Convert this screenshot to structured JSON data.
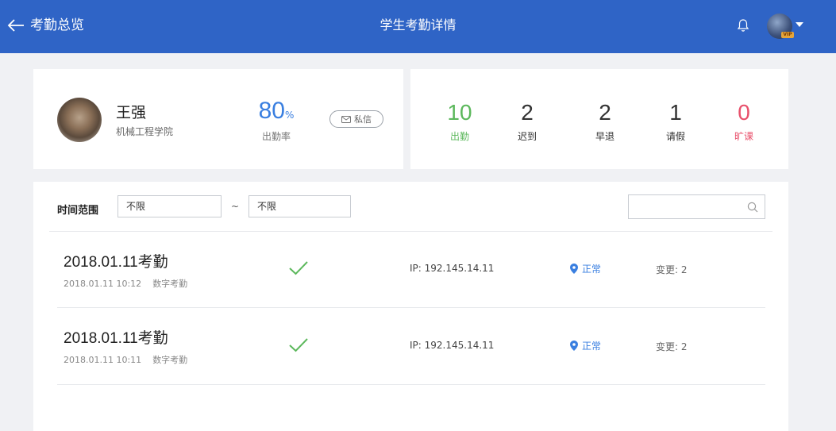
{
  "header": {
    "back_label": "考勤总览",
    "title": "学生考勤详情",
    "vip_badge": "VIP"
  },
  "profile": {
    "name": "王强",
    "school": "机械工程学院",
    "rate_value": "80",
    "rate_unit": "%",
    "rate_label": "出勤率",
    "message_button": "私信"
  },
  "stats": [
    {
      "value": "10",
      "label": "出勤",
      "color": "#5cb85c"
    },
    {
      "value": "2",
      "label": "迟到",
      "color": "#222222"
    },
    {
      "value": "2",
      "label": "早退",
      "color": "#222222"
    },
    {
      "value": "1",
      "label": "请假",
      "color": "#222222"
    },
    {
      "value": "0",
      "label": "旷课",
      "color": "#e8506b"
    }
  ],
  "filter": {
    "label": "时间范围",
    "start_value": "不限",
    "separator": "~",
    "end_value": "不限",
    "search_value": ""
  },
  "records": [
    {
      "title": "2018.01.11考勤",
      "datetime": "2018.01.11  10:12",
      "method": "数字考勤",
      "ip": "IP: 192.145.14.11",
      "status": "正常",
      "change": "变更: 2"
    },
    {
      "title": "2018.01.11考勤",
      "datetime": "2018.01.11  10:11",
      "method": "数字考勤",
      "ip": "IP: 192.145.14.11",
      "status": "正常",
      "change": "变更: 2"
    }
  ],
  "colors": {
    "header_bg": "#2f64c6",
    "accent_blue": "#3a7fe0",
    "check_green": "#5cb85c",
    "absent_red": "#e8506b"
  }
}
